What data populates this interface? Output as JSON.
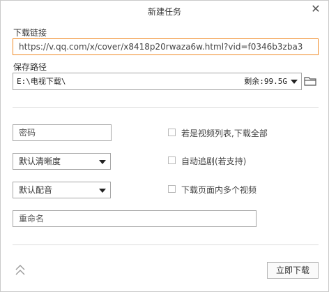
{
  "dialog": {
    "title": "新建任务",
    "close_icon": "close-icon"
  },
  "link": {
    "label": "下载链接",
    "value": "https://v.qq.com/x/cover/x8418p20rwaza6w.html?vid=f0346b3zba3"
  },
  "save_path": {
    "label": "保存路径",
    "value": "E:\\电视下载\\",
    "free_space": "剩余:99.5G",
    "browse_icon": "folder-icon"
  },
  "options": {
    "password_placeholder": "密码",
    "quality_selected": "默认清晰度",
    "audio_selected": "默认配音",
    "rename_placeholder": "重命名",
    "checkboxes": [
      {
        "label": "若是视频列表,下载全部",
        "checked": false
      },
      {
        "label": "自动追剧(若支持)",
        "checked": false
      },
      {
        "label": "下载页面内多个视频",
        "checked": false
      }
    ]
  },
  "footer": {
    "collapse_icon": "double-chevron-up-icon",
    "start_button": "立即下载"
  },
  "colors": {
    "accent_border": "#f08a24",
    "border": "#a5a5a5"
  }
}
